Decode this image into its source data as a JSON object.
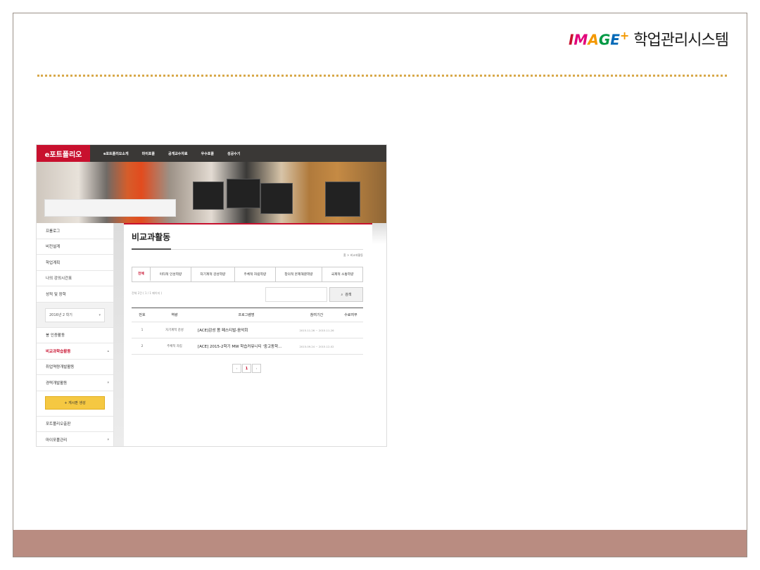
{
  "slide": {
    "brand_logo": {
      "letters": [
        "I",
        "M",
        "A",
        "G",
        "E"
      ],
      "plus": "+"
    },
    "brand_title": "학업관리시스템"
  },
  "screenshot": {
    "gnb": {
      "logo": "e포트폴리오",
      "items": [
        "e포트폴리오소개",
        "마이포폴",
        "공개교수자료",
        "우수포폴",
        "성공수기"
      ]
    },
    "lnb": {
      "items_top": [
        "프롤로그",
        "비전설계",
        "학업계획",
        "나의 강의시간표",
        "성적 및 장학"
      ],
      "semester_select": "2016년 2 학기",
      "items_mid": [
        {
          "label": "봉 인증활동",
          "active": false,
          "chevron": ""
        },
        {
          "label": "비교과학습활동",
          "active": true,
          "chevron": "▴"
        },
        {
          "label": "취업역량개발활동",
          "active": false,
          "chevron": ""
        },
        {
          "label": "경력개발활동",
          "active": false,
          "chevron": "▾"
        }
      ],
      "create_button": "+ 게시판 생성",
      "items_bottom": [
        {
          "label": "포트폴리오출판",
          "chevron": ""
        },
        {
          "label": "마이포폴관리",
          "chevron": "▾"
        }
      ]
    },
    "content": {
      "title": "비교과활동",
      "breadcrumb": "홈 > 비교과활동",
      "tabs": [
        "전체",
        "이타적 인성역량",
        "자기계적 감성역량",
        "주체적 자립역량",
        "창의적 문제해결역량",
        "국제적 소통역량"
      ],
      "count_text": "전체 2건 ( 1 / 1 페이지 )",
      "search_button": "검색",
      "table": {
        "headers": [
          "번호",
          "역량",
          "프로그램명",
          "참여기간",
          "수료여부"
        ],
        "rows": [
          {
            "no": "1",
            "competency": "자기계적 감성",
            "program": "[ACE]감성 봄 페스티벌-음악회",
            "period": "2015.11.26 ~ 2015.11.26",
            "done": ""
          },
          {
            "no": "2",
            "competency": "주체적 자립",
            "program": "[ACE] 2015-2학기 MW 학습커뮤니티 '중고동학…",
            "period": "2015.09.24 ~ 2015.12.02",
            "done": ""
          }
        ]
      },
      "pager": {
        "prev": "‹",
        "current": "1",
        "next": "›"
      }
    }
  }
}
